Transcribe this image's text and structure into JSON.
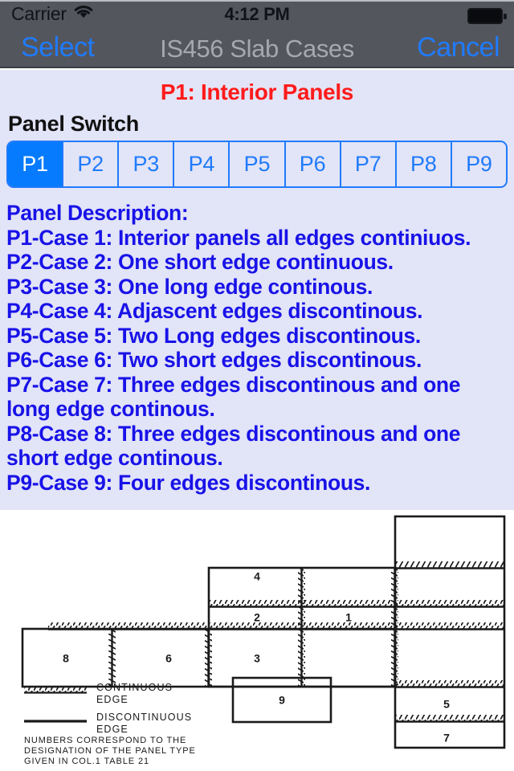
{
  "status_bar": {
    "carrier": "Carrier",
    "wifi_icon": "wifi-icon",
    "time": "4:12 PM",
    "battery_icon": "battery-full-icon"
  },
  "nav_bar": {
    "left_button": "Select",
    "title": "IS456 Slab Cases",
    "right_button": "Cancel"
  },
  "content": {
    "case_title": "P1: Interior Panels",
    "case_title_color": "#ff1b1b",
    "panel_switch_label": "Panel Switch",
    "accent_color": "#067bfd",
    "text_color": "#1812e8",
    "background_color": "#e2e4f7"
  },
  "segmented_control": {
    "selected_index": 0,
    "segments": [
      {
        "label": "P1"
      },
      {
        "label": "P2"
      },
      {
        "label": "P3"
      },
      {
        "label": "P4"
      },
      {
        "label": "P5"
      },
      {
        "label": "P6"
      },
      {
        "label": "P7"
      },
      {
        "label": "P8"
      },
      {
        "label": "P9"
      }
    ]
  },
  "description": {
    "heading": "Panel Description:",
    "lines": [
      "P1-Case 1: Interior panels all edges continiuos.",
      "P2-Case 2: One short edge continuous.",
      "P3-Case 3: One long edge continous.",
      "P4-Case 4: Adjascent edges discontinous.",
      "P5-Case 5: Two Long edges discontinous.",
      "P6-Case 6: Two short edges discontinous.",
      "P7-Case 7: Three edges discontinous and one long edge continous.",
      "P8-Case 8: Three edges discontinous and one short edge continous.",
      "P9-Case 9: Four edges discontinous."
    ]
  },
  "diagram": {
    "panel_labels": [
      "1",
      "2",
      "3",
      "4",
      "5",
      "6",
      "7",
      "8",
      "9"
    ],
    "legend": [
      {
        "symbol": "hatched-line",
        "text_line1": "CONTINUOUS",
        "text_line2": "EDGE"
      },
      {
        "symbol": "plain-line",
        "text_line1": "DISCONTINUOUS",
        "text_line2": "EDGE"
      }
    ],
    "note_lines": [
      "NUMBERS CORRESPOND TO THE",
      "DESIGNATION OF THE PANEL TYPE",
      "GIVEN IN COL.1 TABLE 21"
    ]
  }
}
